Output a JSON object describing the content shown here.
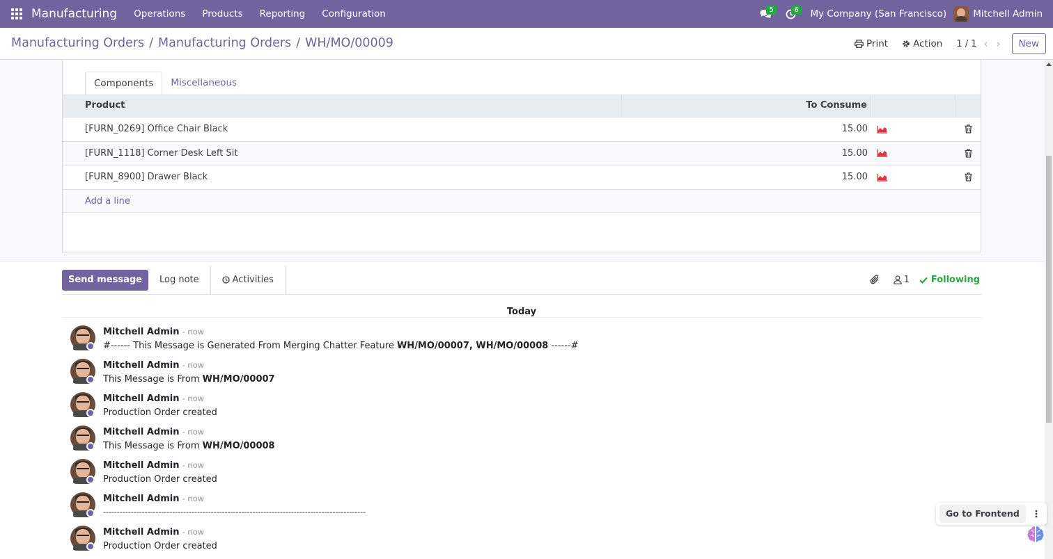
{
  "navbar": {
    "app_title": "Manufacturing",
    "menu": [
      "Operations",
      "Products",
      "Reporting",
      "Configuration"
    ],
    "messages_count": "5",
    "activities_count": "6",
    "company": "My Company (San Francisco)",
    "user": "Mitchell Admin"
  },
  "control_panel": {
    "breadcrumb": [
      "Manufacturing Orders",
      "Manufacturing Orders",
      "WH/MO/00009"
    ],
    "print_label": "Print",
    "action_label": "Action",
    "pager": "1 / 1",
    "new_label": "New"
  },
  "tabs": [
    "Components",
    "Miscellaneous"
  ],
  "components_table": {
    "columns": [
      "Product",
      "To Consume"
    ],
    "rows": [
      {
        "product": "[FURN_0269] Office Chair Black",
        "to_consume": "15.00"
      },
      {
        "product": "[FURN_1118] Corner Desk Left Sit",
        "to_consume": "15.00"
      },
      {
        "product": "[FURN_8900] Drawer Black",
        "to_consume": "15.00"
      }
    ],
    "add_line": "Add a line"
  },
  "chatter": {
    "send_message": "Send message",
    "log_note": "Log note",
    "activities": "Activities",
    "followers_count": "1",
    "following": "Following",
    "today": "Today",
    "messages": [
      {
        "author": "Mitchell Admin",
        "date": "- now",
        "text_pre": "#------ This Message is Generated From Merging Chatter Feature ",
        "text_bold": "WH/MO/00007, WH/MO/00008",
        "text_post": " ------#"
      },
      {
        "author": "Mitchell Admin",
        "date": "- now",
        "text_pre": "This Message is From ",
        "text_bold": "WH/MO/00007",
        "text_post": ""
      },
      {
        "author": "Mitchell Admin",
        "date": "- now",
        "text_pre": "Production Order created",
        "text_bold": "",
        "text_post": ""
      },
      {
        "author": "Mitchell Admin",
        "date": "- now",
        "text_pre": "This Message is From ",
        "text_bold": "WH/MO/00008",
        "text_post": ""
      },
      {
        "author": "Mitchell Admin",
        "date": "- now",
        "text_pre": "Production Order created",
        "text_bold": "",
        "text_post": ""
      },
      {
        "author": "Mitchell Admin",
        "date": "- now",
        "text_pre": "-----------------------------------------------------------------------------------------------",
        "text_bold": "",
        "text_post": ""
      },
      {
        "author": "Mitchell Admin",
        "date": "- now",
        "text_pre": "Production Order created",
        "text_bold": "",
        "text_post": ""
      }
    ]
  },
  "floating": {
    "go_to_frontend": "Go to Frontend"
  },
  "colors": {
    "brand": "#71639e",
    "success": "#28a745",
    "forecast_red": "#dc3545"
  }
}
